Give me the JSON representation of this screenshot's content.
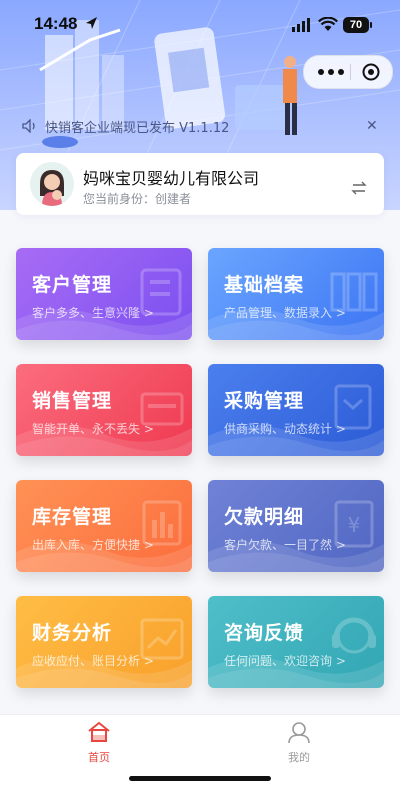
{
  "status_bar": {
    "time": "14:48",
    "battery": "70"
  },
  "notice": {
    "text": "快销客企业端现已发布 V1.1.12"
  },
  "company": {
    "name": "妈咪宝贝婴幼儿有限公司",
    "role": "您当前身份：创建者"
  },
  "modules": [
    {
      "title": "客户管理",
      "subtitle": "客户多多、生意兴隆 >",
      "gradient": [
        "#a86cf5",
        "#7b4ff0"
      ]
    },
    {
      "title": "基础档案",
      "subtitle": "产品管理、数据录入 >",
      "gradient": [
        "#6aa6ff",
        "#3c74f3"
      ]
    },
    {
      "title": "销售管理",
      "subtitle": "智能开单、永不丢失 >",
      "gradient": [
        "#fb6d7e",
        "#ef3950"
      ]
    },
    {
      "title": "采购管理",
      "subtitle": "供商采购、动态统计 >",
      "gradient": [
        "#4b7fee",
        "#2c5bd6"
      ]
    },
    {
      "title": "库存管理",
      "subtitle": "出库入库、方便快捷 >",
      "gradient": [
        "#ff9256",
        "#fb6d3c"
      ]
    },
    {
      "title": "欠款明细",
      "subtitle": "客户欠款、一目了然 >",
      "gradient": [
        "#6f82d6",
        "#5066c2"
      ]
    },
    {
      "title": "财务分析",
      "subtitle": "应收应付、账目分析 >",
      "gradient": [
        "#ffbd45",
        "#f8a02b"
      ]
    },
    {
      "title": "咨询反馈",
      "subtitle": "任何问题、欢迎咨询 >",
      "gradient": [
        "#4fbfc9",
        "#32a6b4"
      ]
    }
  ],
  "tabbar": {
    "items": [
      {
        "label": "首页",
        "active": true,
        "color": "#e8473f"
      },
      {
        "label": "我的",
        "active": false,
        "color": "#9a9a9a"
      }
    ]
  }
}
